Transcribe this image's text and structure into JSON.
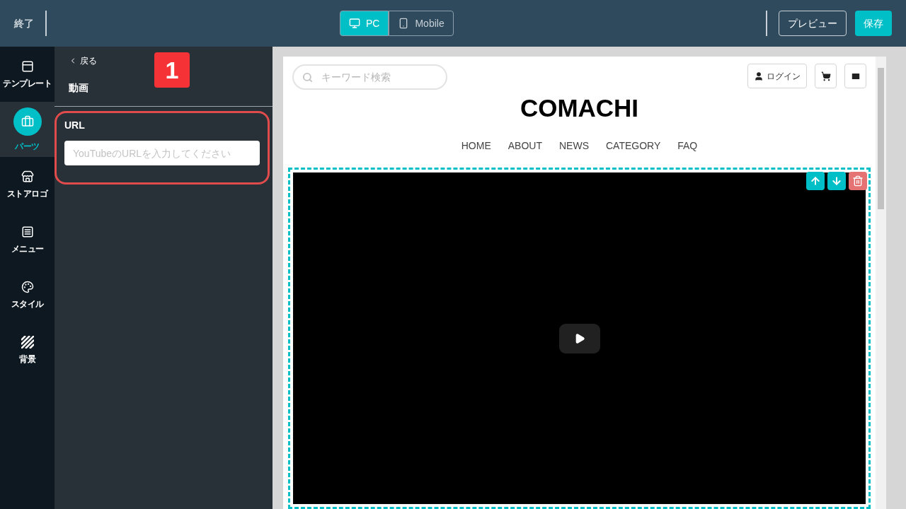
{
  "topbar": {
    "exit": "終了",
    "devices": [
      {
        "label": "PC",
        "kind": "desktop",
        "selected": true
      },
      {
        "label": "Mobile",
        "kind": "mobile",
        "selected": false
      }
    ],
    "preview": "プレビュー",
    "save": "保存"
  },
  "sidebar": {
    "items": [
      {
        "label": "テンプレート",
        "kind": "template",
        "selected": false
      },
      {
        "label": "パーツ",
        "kind": "parts",
        "selected": true
      },
      {
        "label": "ストアロゴ",
        "kind": "store",
        "selected": false
      },
      {
        "label": "メニュー",
        "kind": "menu",
        "selected": false
      },
      {
        "label": "スタイル",
        "kind": "style",
        "selected": false
      },
      {
        "label": "背景",
        "kind": "background",
        "selected": false
      }
    ]
  },
  "panel": {
    "back": "戻る",
    "title": "動画",
    "marker": "1",
    "field_label": "URL",
    "placeholder": "YouTubeのURLを入力してください"
  },
  "site": {
    "search_placeholder": "キーワード検索",
    "login": "ログイン",
    "logo": "COMACHI",
    "nav": [
      "HOME",
      "ABOUT",
      "NEWS",
      "CATEGORY",
      "FAQ"
    ]
  }
}
